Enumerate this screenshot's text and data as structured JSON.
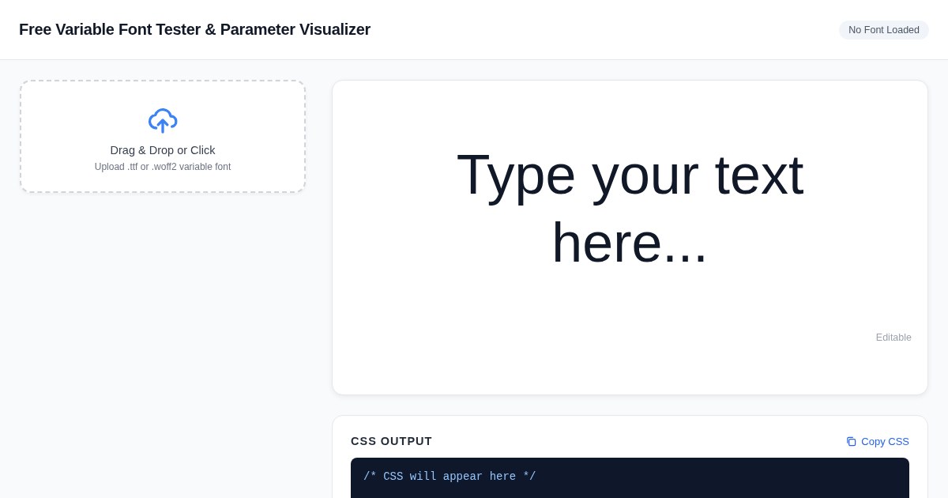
{
  "header": {
    "title": "Free Variable Font Tester & Parameter Visualizer",
    "status_badge": "No Font Loaded"
  },
  "upload": {
    "title": "Drag & Drop or Click",
    "hint": "Upload .ttf or .woff2 variable font"
  },
  "preview": {
    "text": "Type your text here...",
    "note": "Editable"
  },
  "css_output": {
    "heading": "CSS OUTPUT",
    "copy_button": "Copy CSS",
    "code": "/* CSS will appear here */"
  }
}
